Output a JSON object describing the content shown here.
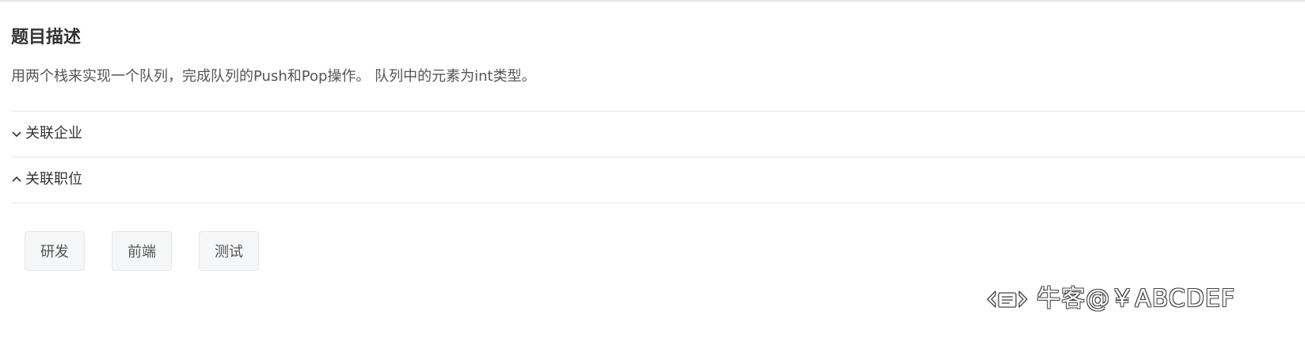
{
  "problem": {
    "heading": "题目描述",
    "description": "用两个栈来实现一个队列，完成队列的Push和Pop操作。 队列中的元素为int类型。"
  },
  "sections": [
    {
      "label": "关联企业",
      "expanded": false,
      "icon": "chevron-down-icon"
    },
    {
      "label": "关联职位",
      "expanded": true,
      "icon": "chevron-up-icon"
    }
  ],
  "position_tags": [
    "研发",
    "前端",
    "测试"
  ],
  "watermark": {
    "text": "牛客@￥ABCDEF",
    "icon": "nowcoder-logo-icon"
  }
}
